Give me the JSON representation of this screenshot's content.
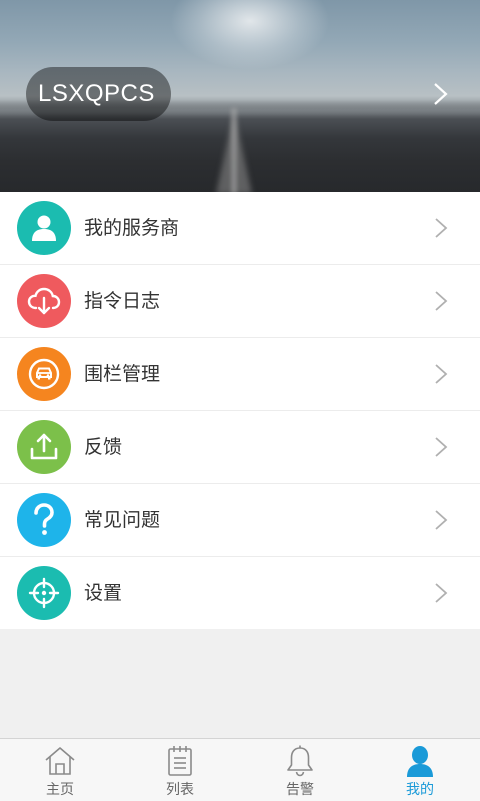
{
  "profile": {
    "username": "LSXQPCS"
  },
  "menu": {
    "items": [
      {
        "label": "我的服务商",
        "icon": "person-icon",
        "color": "#1bbcb0"
      },
      {
        "label": "指令日志",
        "icon": "cloud-download-icon",
        "color": "#ef5a5e"
      },
      {
        "label": "围栏管理",
        "icon": "car-fence-icon",
        "color": "#f5851f"
      },
      {
        "label": "反馈",
        "icon": "upload-icon",
        "color": "#7cc04a"
      },
      {
        "label": "常见问题",
        "icon": "question-icon",
        "color": "#1eb4ea"
      },
      {
        "label": "设置",
        "icon": "crosshair-icon",
        "color": "#1bbcb0"
      }
    ]
  },
  "tabs": [
    {
      "label": "主页",
      "icon": "home-icon",
      "active": false
    },
    {
      "label": "列表",
      "icon": "list-icon",
      "active": false
    },
    {
      "label": "告警",
      "icon": "bell-icon",
      "active": false
    },
    {
      "label": "我的",
      "icon": "profile-icon",
      "active": true
    }
  ],
  "colors": {
    "accent": "#1a9ad8",
    "tab_inactive": "#666666"
  }
}
